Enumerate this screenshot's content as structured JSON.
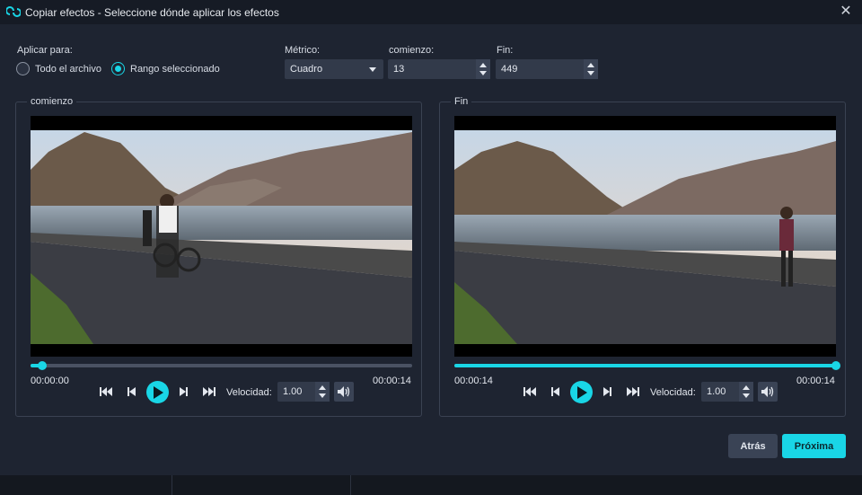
{
  "window": {
    "title": "Copiar efectos - Seleccione dónde aplicar los efectos",
    "icon": "loop-icon"
  },
  "apply": {
    "label": "Aplicar para:",
    "options": [
      {
        "label": "Todo el archivo",
        "selected": false
      },
      {
        "label": "Rango seleccionado",
        "selected": true
      }
    ]
  },
  "metric": {
    "label": "Métrico:",
    "value": "Cuadro"
  },
  "start": {
    "label": "comienzo:",
    "value": "13"
  },
  "end": {
    "label": "Fin:",
    "value": "449"
  },
  "panels": {
    "start": {
      "title": "comienzo",
      "progress": 0.03,
      "time_current": "00:00:00",
      "time_total": "00:00:14",
      "speed_label": "Velocidad:",
      "speed_value": "1.00"
    },
    "end": {
      "title": "Fin",
      "progress": 1.0,
      "time_current": "00:00:14",
      "time_total": "00:00:14",
      "speed_label": "Velocidad:",
      "speed_value": "1.00"
    }
  },
  "footer": {
    "back_label": "Atrás",
    "next_label": "Próxima"
  },
  "colors": {
    "accent": "#19d6e6",
    "background": "#1e2431",
    "titlebar": "#161b25"
  }
}
